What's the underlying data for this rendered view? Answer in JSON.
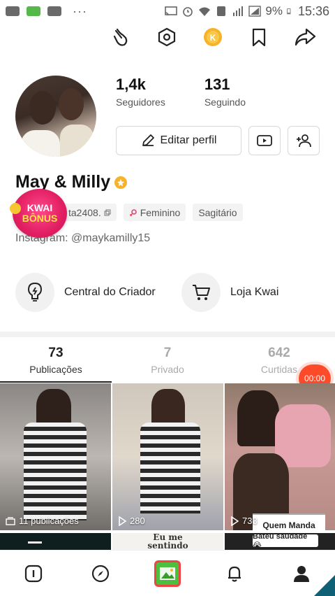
{
  "status_bar": {
    "time": "15:36",
    "battery_pct": "9%",
    "more": "···"
  },
  "profile": {
    "name": "May & Milly",
    "followers_count": "1,4k",
    "followers_label": "Seguidores",
    "following_count": "131",
    "following_label": "Seguindo",
    "edit_label": "Editar perfil",
    "id_tag": "ta2408.",
    "gender_tag": "Feminino",
    "sign_tag": "Sagitário",
    "instagram": "Instagram: @maykamilly15"
  },
  "bonus": {
    "line1": "KWAI",
    "line2": "BÔNUS"
  },
  "quick_links": [
    {
      "label": "Central do Criador"
    },
    {
      "label": "Loja Kwai"
    }
  ],
  "tabs": [
    {
      "count": "73",
      "label": "Publicações"
    },
    {
      "count": "7",
      "label": "Privado"
    },
    {
      "count": "642",
      "label": "Curtidas"
    }
  ],
  "timer": "00:00",
  "grid": {
    "tile1_label": "11 publicações",
    "tile2_views": "280",
    "tile3_views": "733",
    "tile3_caption": "Quem Manda",
    "row2_text_line1": "Eu me",
    "row2_text_line2": "sentindo",
    "row2_bubble": "Bateu saudade 😭"
  },
  "icons": {
    "top": [
      "hand-wave-icon",
      "hexagon-settings-icon",
      "kwai-coin-icon",
      "bookmark-icon",
      "share-icon"
    ],
    "nav": [
      "home-icon",
      "discover-icon",
      "camera-icon",
      "notifications-icon",
      "profile-icon"
    ]
  },
  "colors": {
    "accent": "#ff4a2a",
    "bonus": "#e21e63",
    "coin": "#f6b32a"
  }
}
